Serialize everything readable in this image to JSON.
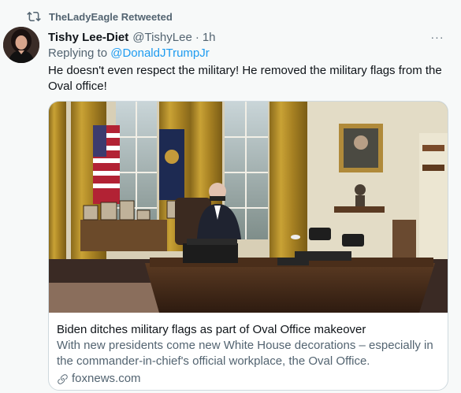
{
  "retweet": {
    "label": "TheLadyEagle Retweeted"
  },
  "tweet": {
    "name": "Tishy Lee-Diet",
    "handle": "@TishyLee",
    "separator": "·",
    "time": "1h",
    "more_label": "···",
    "reply_prefix": "Replying to ",
    "reply_to": "@DonaldJTrumpJr",
    "text": "He doesn't even respect the military! He removed the military flags from the Oval office!"
  },
  "card": {
    "title": "Biden ditches military flags as part of Oval Office makeover",
    "description": "With new presidents come new White House decorations – especially in the commander-in-chief's official workplace, the Oval Office.",
    "source": "foxnews.com"
  },
  "colors": {
    "link": "#1d9bf0",
    "secondary": "#536471",
    "text": "#0f1419",
    "border": "#cfd9de"
  }
}
